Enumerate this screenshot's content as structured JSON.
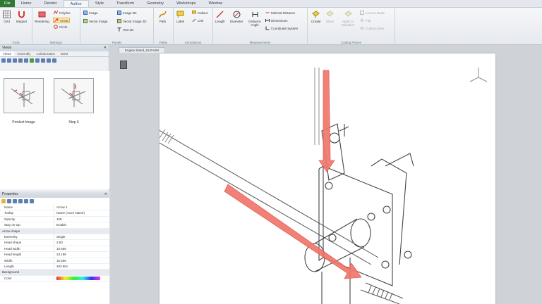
{
  "menu": {
    "tabs": [
      "File",
      "Home",
      "Render",
      "Author",
      "Style",
      "Transform",
      "Geometry",
      "Workshops",
      "Window"
    ],
    "active_index": 3
  },
  "ribbon": {
    "groups": [
      "Tools",
      "Markups",
      "Panels",
      "Paths",
      "Annotations",
      "Measurements",
      "Cutting Planes"
    ],
    "tools": [
      "Grid",
      "Magnet"
    ],
    "markups": [
      "Rendering",
      "Polyline",
      "Arrow",
      "Circle"
    ],
    "panels": [
      "Image",
      "Vector Image",
      "Image 2D",
      "Vector Image 2D",
      "Text 2D"
    ],
    "paths": [
      "Path"
    ],
    "annotations": [
      "Label",
      "Callout",
      "Link"
    ],
    "measurements": [
      "Length",
      "Diameter",
      "Distance Angle",
      "Minimal Distance",
      "Dimensions",
      "Coordinate System"
    ],
    "cutting": [
      "Create",
      "Move",
      "Apply to Selection",
      "Lesson Mode",
      "Flip",
      "Cutting Lines"
    ]
  },
  "views_panel": {
    "title": "Views",
    "tabs": [
      "Views",
      "Assembly",
      "Collaboration",
      "BOM"
    ],
    "thumbnails": [
      "Product Image",
      "Step 6"
    ]
  },
  "properties": {
    "title": "Properties",
    "rows": [
      {
        "k": "Name",
        "v": "Arrow 1",
        "cat": false
      },
      {
        "k": "Tooltip",
        "v": "Name (Actor Name)",
        "cat": false
      },
      {
        "k": "Opacity",
        "v": "128",
        "cat": false
      },
      {
        "k": "Stay on top",
        "v": "Enable",
        "cat": false
      },
      {
        "k": "Arrow shape",
        "v": "",
        "cat": true
      },
      {
        "k": "Extremity",
        "v": "Single",
        "cat": false
      },
      {
        "k": "Head shape",
        "v": "2.50",
        "cat": false
      },
      {
        "k": "Head width",
        "v": "10.556",
        "cat": false
      },
      {
        "k": "Head length",
        "v": "23.198",
        "cat": false
      },
      {
        "k": "Width",
        "v": "15.556",
        "cat": false
      },
      {
        "k": "Length",
        "v": "293.961",
        "cat": false
      },
      {
        "k": "Background",
        "v": "",
        "cat": true
      },
      {
        "k": "Color",
        "v": "",
        "cat": false
      }
    ]
  },
  "document": {
    "tab": "Engine Stand_SLDASM"
  },
  "colors": {
    "arrow": "#f0766b",
    "file_tab": "#2f7a32",
    "accent": "#1f4a84"
  }
}
